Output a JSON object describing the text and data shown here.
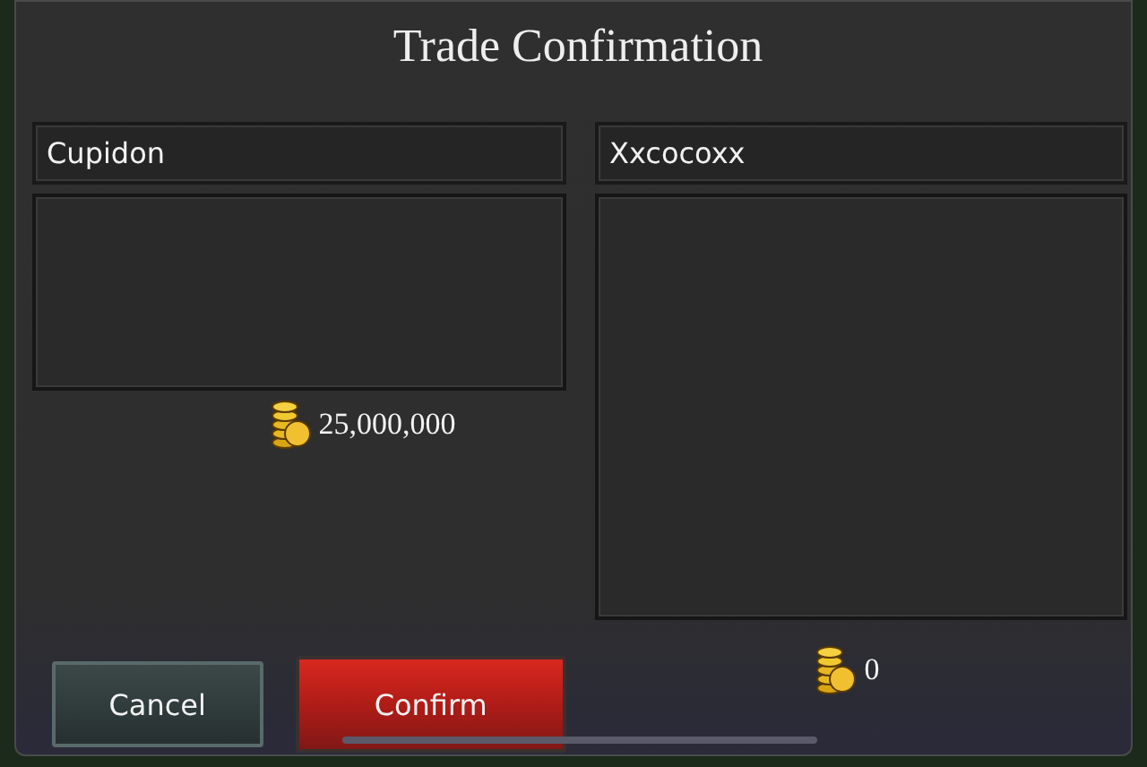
{
  "dialog": {
    "title": "Trade Confirmation"
  },
  "left_offer": {
    "player": "Cupidon",
    "gold": "25,000,000"
  },
  "right_offer": {
    "player": "Xxcocoxx",
    "gold": "0"
  },
  "buttons": [
    {
      "kind": "cancel",
      "label": "Cancel"
    },
    {
      "kind": "confirm",
      "label": "Confirm"
    }
  ]
}
